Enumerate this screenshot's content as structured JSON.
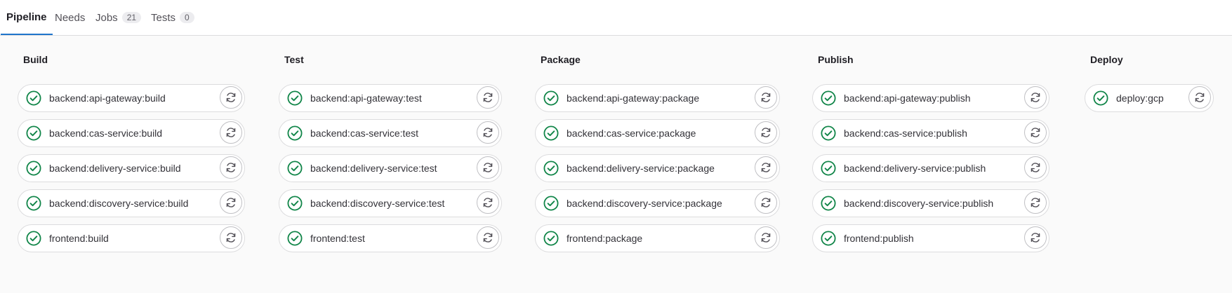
{
  "tabs": [
    {
      "label": "Pipeline",
      "active": true
    },
    {
      "label": "Needs"
    },
    {
      "label": "Jobs",
      "count": "21"
    },
    {
      "label": "Tests",
      "count": "0"
    }
  ],
  "colors": {
    "success": "#108548",
    "active_tab_underline": "#1f75cb",
    "background": "#fafafa"
  },
  "icons": {
    "job_status": "check-circle-icon",
    "job_action": "retry-icon"
  },
  "stages": [
    {
      "name": "Build",
      "jobs": [
        {
          "name": "backend:api-gateway:build",
          "status": "success"
        },
        {
          "name": "backend:cas-service:build",
          "status": "success"
        },
        {
          "name": "backend:delivery-service:build",
          "status": "success"
        },
        {
          "name": "backend:discovery-service:build",
          "status": "success"
        },
        {
          "name": "frontend:build",
          "status": "success"
        }
      ]
    },
    {
      "name": "Test",
      "jobs": [
        {
          "name": "backend:api-gateway:test",
          "status": "success"
        },
        {
          "name": "backend:cas-service:test",
          "status": "success"
        },
        {
          "name": "backend:delivery-service:test",
          "status": "success"
        },
        {
          "name": "backend:discovery-service:test",
          "status": "success"
        },
        {
          "name": "frontend:test",
          "status": "success"
        }
      ]
    },
    {
      "name": "Package",
      "jobs": [
        {
          "name": "backend:api-gateway:package",
          "status": "success"
        },
        {
          "name": "backend:cas-service:package",
          "status": "success"
        },
        {
          "name": "backend:delivery-service:package",
          "status": "success"
        },
        {
          "name": "backend:discovery-service:package",
          "status": "success"
        },
        {
          "name": "frontend:package",
          "status": "success"
        }
      ]
    },
    {
      "name": "Publish",
      "jobs": [
        {
          "name": "backend:api-gateway:publish",
          "status": "success"
        },
        {
          "name": "backend:cas-service:publish",
          "status": "success"
        },
        {
          "name": "backend:delivery-service:publish",
          "status": "success"
        },
        {
          "name": "backend:discovery-service:publish",
          "status": "success"
        },
        {
          "name": "frontend:publish",
          "status": "success"
        }
      ]
    },
    {
      "name": "Deploy",
      "jobs": [
        {
          "name": "deploy:gcp",
          "status": "success"
        }
      ]
    }
  ]
}
